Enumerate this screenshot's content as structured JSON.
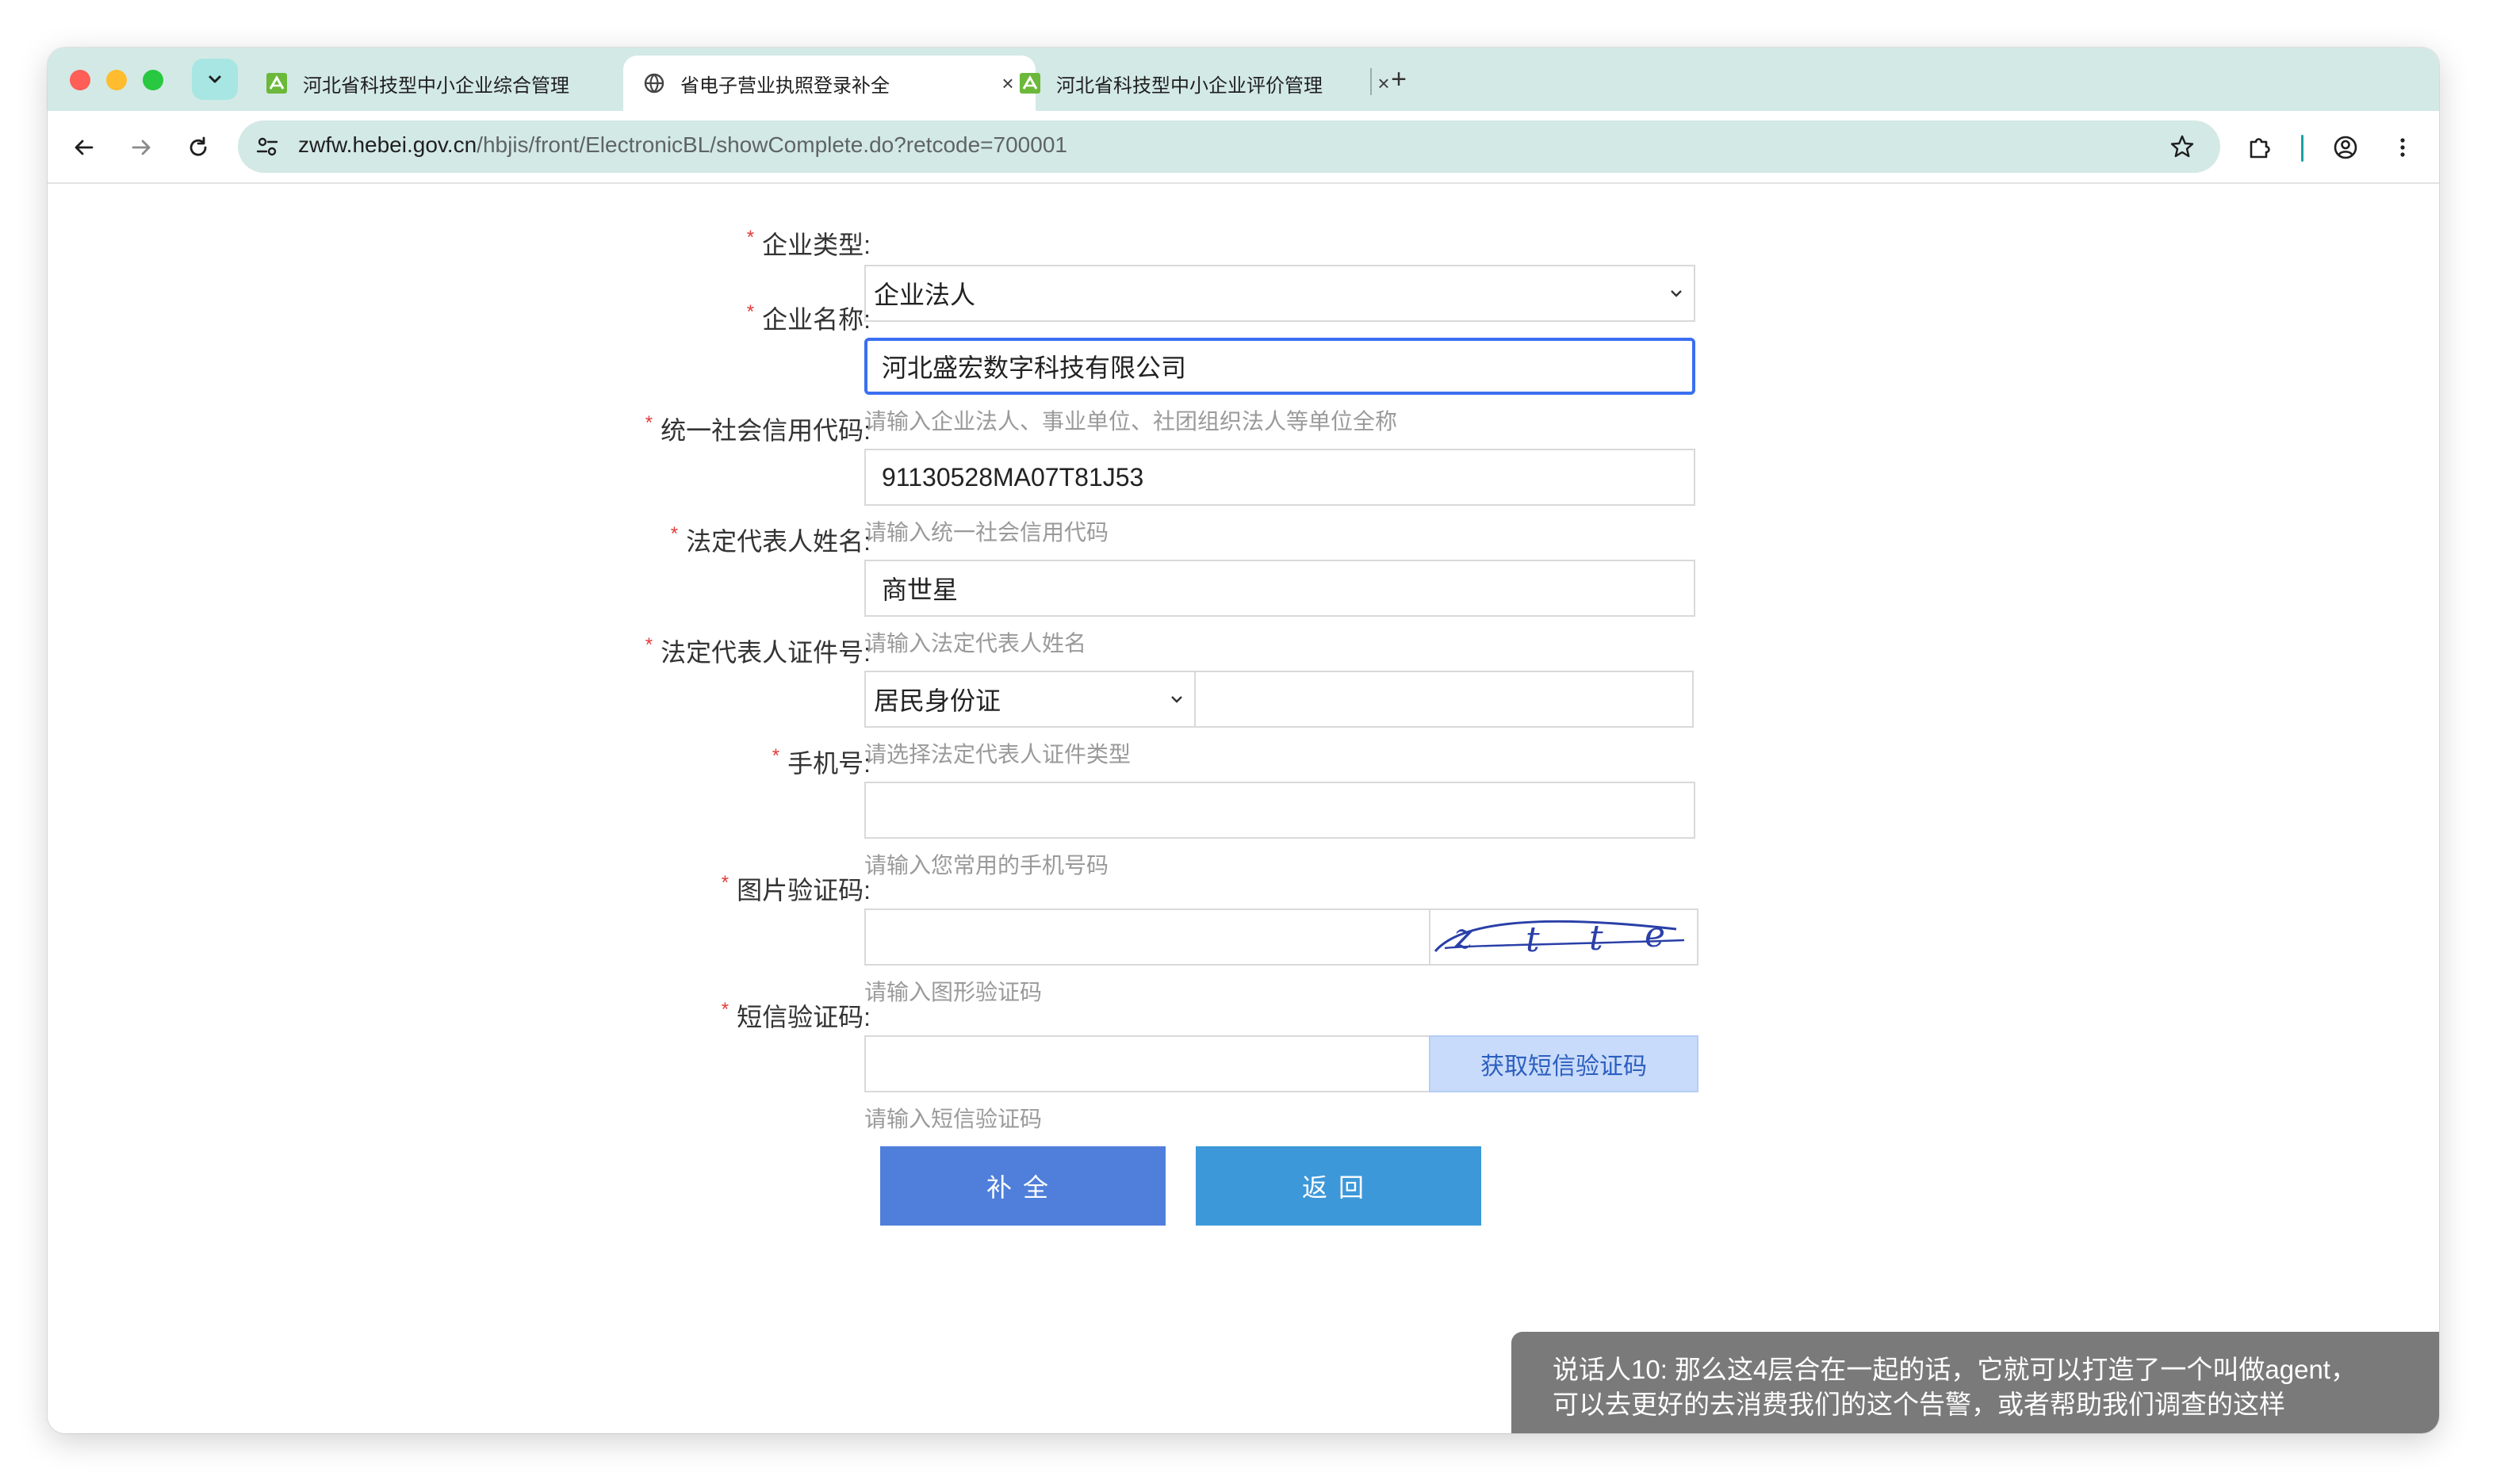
{
  "browser": {
    "tabs": [
      {
        "title": "河北省科技型中小企业综合管理",
        "active": false
      },
      {
        "title": "省电子营业执照登录补全",
        "active": true
      },
      {
        "title": "河北省科技型中小企业评价管理",
        "active": false
      }
    ],
    "tab_close_glyph": "×",
    "new_tab_glyph": "+",
    "url_host": "zwfw.hebei.gov.cn",
    "url_path": "/hbjis/front/ElectronicBL/showComplete.do?retcode=700001"
  },
  "form": {
    "required_mark": "*",
    "company_type": {
      "label": "企业类型:",
      "value": "企业法人"
    },
    "company_name": {
      "label": "企业名称:",
      "value": "河北盛宏数字科技有限公司",
      "hint": "请输入企业法人、事业单位、社团组织法人等单位全称"
    },
    "credit_code": {
      "label": "统一社会信用代码:",
      "value": "91130528MA07T81J53",
      "hint": "请输入统一社会信用代码"
    },
    "legal_rep_name": {
      "label": "法定代表人姓名:",
      "value": "商世星",
      "hint": "请输入法定代表人姓名"
    },
    "legal_rep_id": {
      "label": "法定代表人证件号:",
      "id_type": "居民身份证",
      "value": "",
      "hint": "请选择法定代表人证件类型"
    },
    "phone": {
      "label": "手机号:",
      "value": "",
      "hint": "请输入您常用的手机号码"
    },
    "image_captcha": {
      "label": "图片验证码:",
      "value": "",
      "hint": "请输入图形验证码",
      "captcha_text": "ztte"
    },
    "sms_code": {
      "label": "短信验证码:",
      "value": "",
      "hint": "请输入短信验证码",
      "button": "获取短信验证码"
    },
    "submit_button": "补全",
    "back_button": "返回"
  },
  "subtitle": {
    "line1": "说话人10: 那么这4层合在一起的话，它就可以打造了一个叫做agent，",
    "line2": "可以去更好的去消费我们的这个告警，或者帮助我们调查的这样"
  },
  "colors": {
    "tabstrip": "#d3e9e5",
    "required": "#e23a3a",
    "focus_border": "#3a6ff0",
    "submit_button": "#4f7fdb",
    "back_button": "#3c98d9",
    "sms_button": "#c9dbfa"
  },
  "icons": [
    "tab-search-icon",
    "gov-favicon-icon",
    "globe-icon",
    "close-icon",
    "plus-icon",
    "back-arrow-icon",
    "forward-arrow-icon",
    "reload-icon",
    "site-settings-icon",
    "star-icon",
    "extensions-icon",
    "profile-icon",
    "menu-icon",
    "chevron-down-icon"
  ]
}
